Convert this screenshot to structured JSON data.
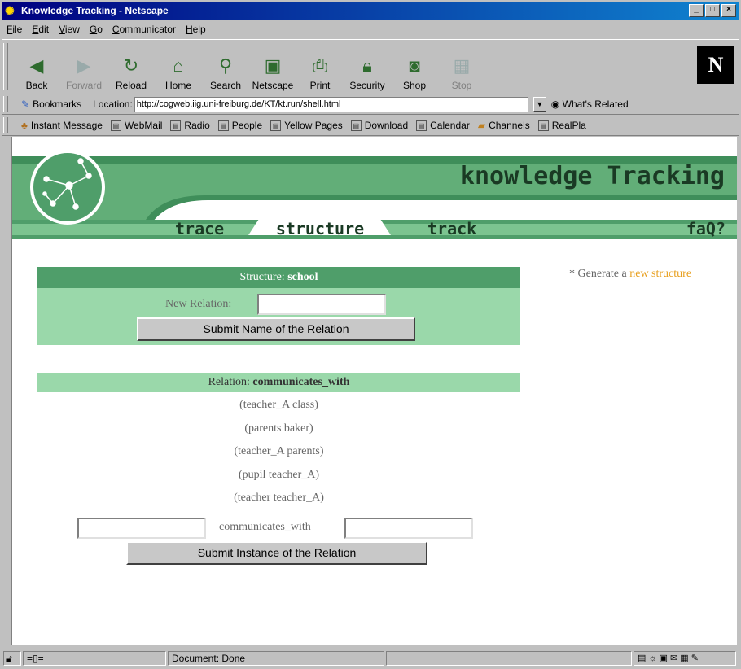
{
  "window": {
    "title": "Knowledge Tracking - Netscape"
  },
  "menu": [
    {
      "u": "F",
      "rest": "ile"
    },
    {
      "u": "E",
      "rest": "dit"
    },
    {
      "u": "V",
      "rest": "iew"
    },
    {
      "u": "G",
      "rest": "o"
    },
    {
      "u": "C",
      "rest": "ommunicator"
    },
    {
      "u": "H",
      "rest": "elp"
    }
  ],
  "toolbar": {
    "back": "Back",
    "forward": "Forward",
    "reload": "Reload",
    "home": "Home",
    "search": "Search",
    "netscape": "Netscape",
    "print": "Print",
    "security": "Security",
    "shop": "Shop",
    "stop": "Stop"
  },
  "location": {
    "bookmarks": "Bookmarks",
    "label": "Location:",
    "url": "http://cogweb.iig.uni-freiburg.de/KT/kt.run/shell.html",
    "whats_related": "What's Related"
  },
  "personal": [
    "Instant Message",
    "WebMail",
    "Radio",
    "People",
    "Yellow Pages",
    "Download",
    "Calendar",
    "Channels",
    "RealPla"
  ],
  "banner": {
    "title": "knowledge Tracking",
    "tabs": {
      "trace": "trace",
      "structure": "structure",
      "track": "track",
      "faq": "faQ?"
    }
  },
  "structure": {
    "label": "Structure: ",
    "name": "school",
    "new_relation_label": "New Relation:",
    "new_relation_value": "",
    "submit_name": "Submit Name of the Relation"
  },
  "relation": {
    "label": "Relation: ",
    "name": "communicates_with",
    "pairs": [
      "(teacher_A class)",
      "(parents baker)",
      "(teacher_A parents)",
      "(pupil teacher_A)",
      "(teacher teacher_A)"
    ],
    "connector": "communicates_with",
    "submit_instance": "Submit Instance of the Relation"
  },
  "side": {
    "prefix": "* Generate a ",
    "link": "new structure"
  },
  "status": {
    "text": "Document: Done"
  },
  "colors": {
    "title_bar": "#000080",
    "dark_green": "#4f9e6a",
    "light_green": "#9ad8aa",
    "link_orange": "#e8a020"
  }
}
